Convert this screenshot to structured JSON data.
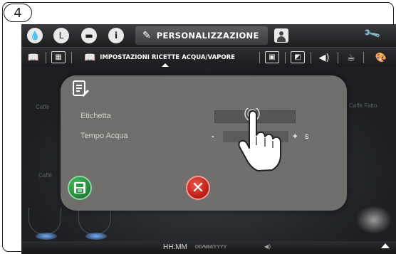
{
  "step_badge": "4",
  "topbar": {
    "tabs": [
      {
        "icon": "water-drop-icon",
        "glyph": "●"
      },
      {
        "icon": "clock-icon",
        "glyph": "L"
      },
      {
        "icon": "cup-icon",
        "glyph": "▬"
      },
      {
        "icon": "info-icon",
        "glyph": "i"
      }
    ],
    "active_tab": {
      "icon": "pencil-icon",
      "glyph": "✎",
      "label": "PERSONALIZZAZIONE"
    },
    "user_icon": "user-icon",
    "wrench_icon": "wrench-icon"
  },
  "subbar": {
    "active_label": "IMPOSTAZIONI RICETTE ACQUA/VAPORE",
    "icons": [
      "book-icon",
      "book-icon",
      "book-icon",
      "picture-icon",
      "screen-icon",
      "speaker-icon",
      "coffee-pot-icon",
      "palette-icon"
    ]
  },
  "background": {
    "left_label_1": "Caffè",
    "left_label_2": "Caffè",
    "right_label_1": "Caffè Fatto"
  },
  "dialog": {
    "label_etichetta": "Etichetta",
    "label_tempo_acqua": "Tempo Acqua",
    "stepper_minus": "-",
    "stepper_plus": "+",
    "unit": "s",
    "save_icon": "save-icon",
    "cancel_icon": "cancel-icon",
    "cancel_glyph": "✕"
  },
  "statusbar": {
    "time": "HH:MM",
    "date": "DD/MM/YYYY",
    "volume_glyph": "◀)",
    "volume_icon": "speaker-icon"
  },
  "colors": {
    "save_green": "#2a9a45",
    "cancel_red": "#d9281d",
    "screen_bg": "#151618",
    "dialog_bg": "#767472"
  }
}
